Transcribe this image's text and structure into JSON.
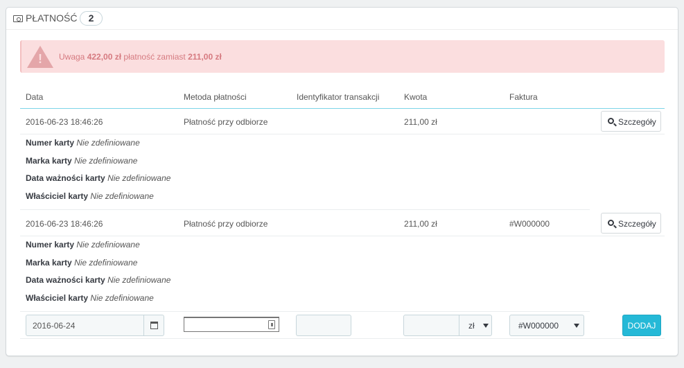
{
  "panel": {
    "title": "PŁATNOŚĆ",
    "count": "2",
    "icon": "money-icon"
  },
  "alert": {
    "icon": "warning-icon",
    "prefix": "Uwaga ",
    "amount_paid": "422,00 zł",
    "middle": " płatność zamiast ",
    "amount_expected": "211,00 zł",
    "color_bg": "#fbdedf",
    "color_text": "#d67a80"
  },
  "table": {
    "headers": {
      "date": "Data",
      "method": "Metoda płatności",
      "transaction": "Identyfikator transakcji",
      "amount": "Kwota",
      "invoice": "Faktura"
    },
    "rows": [
      {
        "date": "2016-06-23 18:46:26",
        "method": "Płatność przy odbiorze",
        "transaction": "",
        "amount": "211,00 zł",
        "invoice": "",
        "details_label": "Szczegóły",
        "card_number_label": "Numer karty",
        "card_number": "Nie zdefiniowane",
        "card_brand_label": "Marka karty",
        "card_brand": "Nie zdefiniowane",
        "card_expiry_label": "Data ważności karty",
        "card_expiry": "Nie zdefiniowane",
        "card_holder_label": "Właściciel karty",
        "card_holder": "Nie zdefiniowane"
      },
      {
        "date": "2016-06-23 18:46:26",
        "method": "Płatność przy odbiorze",
        "transaction": "",
        "amount": "211,00 zł",
        "invoice": "#W000000",
        "details_label": "Szczegóły",
        "card_number_label": "Numer karty",
        "card_number": "Nie zdefiniowane",
        "card_brand_label": "Marka karty",
        "card_brand": "Nie zdefiniowane",
        "card_expiry_label": "Data ważności karty",
        "card_expiry": "Nie zdefiniowane",
        "card_holder_label": "Właściciel karty",
        "card_holder": "Nie zdefiniowane"
      }
    ]
  },
  "form": {
    "date_value": "2016-06-24",
    "method_value": "",
    "transaction_value": "",
    "amount_value": "",
    "currency_selected": "zł",
    "invoice_selected": "#W000000",
    "add_label": "DODAJ",
    "accent_color": "#25b9d7"
  }
}
